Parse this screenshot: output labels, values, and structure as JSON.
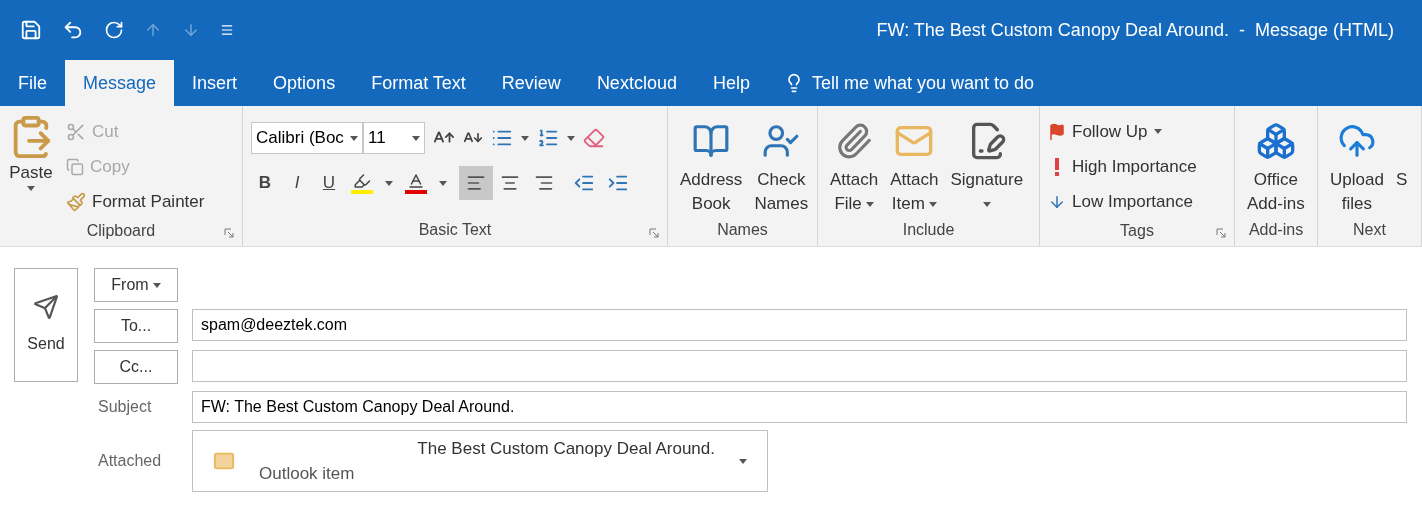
{
  "window": {
    "title": "FW: The Best Custom Canopy Deal Around.  -  Message (HTML)"
  },
  "tabs": [
    {
      "label": "File",
      "selected": false
    },
    {
      "label": "Message",
      "selected": true
    },
    {
      "label": "Insert",
      "selected": false
    },
    {
      "label": "Options",
      "selected": false
    },
    {
      "label": "Format Text",
      "selected": false
    },
    {
      "label": "Review",
      "selected": false
    },
    {
      "label": "Nextcloud",
      "selected": false
    },
    {
      "label": "Help",
      "selected": false
    }
  ],
  "tell_me": {
    "placeholder": "Tell me what you want to do"
  },
  "ribbon": {
    "clipboard": {
      "label": "Clipboard",
      "launcher": true,
      "paste": {
        "label": "Paste"
      },
      "cut": {
        "label": "Cut",
        "disabled": true
      },
      "copy": {
        "label": "Copy",
        "disabled": true
      },
      "format_painter": {
        "label": "Format Painter",
        "disabled": false
      }
    },
    "basic_text": {
      "label": "Basic Text",
      "launcher": true,
      "font": "Calibri (Boc",
      "size": "11",
      "bold": "B",
      "italic": "I",
      "underline": "U",
      "align": [
        {
          "selected": true
        },
        {
          "selected": false
        },
        {
          "selected": false
        }
      ]
    },
    "names": {
      "label": "Names",
      "launcher": false,
      "items": [
        {
          "lines": [
            "Address",
            "Book"
          ],
          "dropdown": false
        },
        {
          "lines": [
            "Check",
            "Names"
          ],
          "dropdown": false
        }
      ]
    },
    "include": {
      "label": "Include",
      "launcher": false,
      "items": [
        {
          "lines": [
            "Attach",
            "File"
          ],
          "dropdown": true
        },
        {
          "lines": [
            "Attach",
            "Item"
          ],
          "dropdown": true
        },
        {
          "lines": [
            "Signature"
          ],
          "dropdown": true
        }
      ]
    },
    "tags": {
      "label": "Tags",
      "launcher": true,
      "follow_up": {
        "label": "Follow Up",
        "dropdown": true
      },
      "high": {
        "label": "High Importance"
      },
      "low": {
        "label": "Low Importance"
      }
    },
    "add_ins": {
      "label": "Add-ins",
      "launcher": false,
      "items": [
        {
          "lines": [
            "Office",
            "Add-ins"
          ],
          "dropdown": false
        }
      ]
    },
    "next": {
      "label": "Next",
      "launcher": false,
      "items": [
        {
          "lines": [
            "Upload",
            "files"
          ],
          "dropdown": false
        },
        {
          "lines": [
            "S"
          ],
          "dropdown": false
        }
      ]
    }
  },
  "compose": {
    "send": {
      "label": "Send"
    },
    "from": {
      "label": "From"
    },
    "to": {
      "label": "To...",
      "value": "spam@deeztek.com"
    },
    "cc": {
      "label": "Cc..."
    },
    "subject": {
      "label": "Subject",
      "value": "FW: The Best Custom Canopy Deal Around."
    },
    "attached": {
      "label": "Attached",
      "name": "The Best Custom Canopy Deal Around.",
      "type": "Outlook item"
    }
  }
}
